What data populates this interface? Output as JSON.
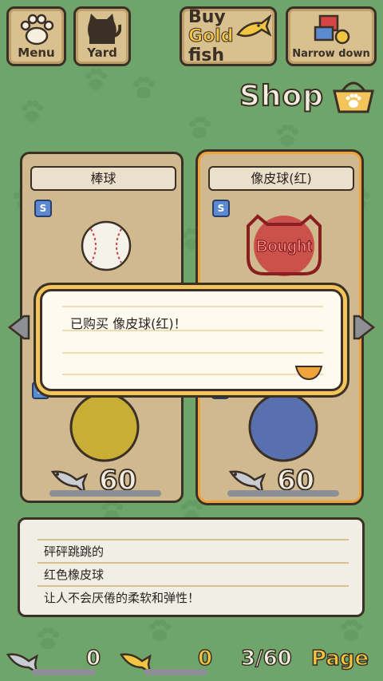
{
  "nav": {
    "menu_label": "Menu",
    "yard_label": "Yard",
    "buy_line1": "Buy",
    "buy_gold": "Gold",
    "buy_fish": "fish",
    "narrow_label": "Narrow down"
  },
  "shop": {
    "title": "Shop"
  },
  "cards": [
    {
      "name": "棒球",
      "badge": "S",
      "price": "60"
    },
    {
      "name": "像皮球(红)",
      "badge": "S",
      "bought_label": "Bought",
      "price": "60"
    },
    {
      "badge": "S",
      "price": "60",
      "ball_color": "#c9ae35"
    },
    {
      "badge": "S",
      "price": "60",
      "ball_color": "#5870ad"
    }
  ],
  "dialog": {
    "message": "已购买 像皮球(红)！"
  },
  "description": {
    "lines": [
      "砰砰跳跳的",
      "红色橡皮球",
      "让人不会厌倦的柔软和弹性！"
    ]
  },
  "footer": {
    "silver_count": "0",
    "gold_count": "0",
    "page": "3/60",
    "page_label": "Page"
  },
  "colors": {
    "background": "#6fa46a",
    "card": "#d0b88f",
    "selected_border": "#f0a33a",
    "gold_text": "#f2c640"
  }
}
